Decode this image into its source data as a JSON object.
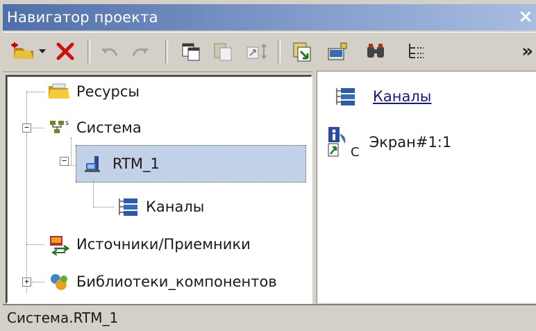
{
  "window": {
    "title": "Навигатор проекта",
    "close": "×"
  },
  "toolbar": {
    "items": [
      "new-icon",
      "dropdown-arrow-icon",
      "delete-icon",
      "undo-icon",
      "redo-icon",
      "copy-icon",
      "paste-icon",
      "move-icon",
      "export-icon",
      "properties-icon",
      "find-icon",
      "tree-view-icon"
    ],
    "overflow": "»"
  },
  "tree": {
    "resources": "Ресурсы",
    "system": "Система",
    "rtm": "RTM_1",
    "channels": "Каналы",
    "sources": "Источники/Приемники",
    "libraries": "Библиотеки_компонентов"
  },
  "list": {
    "channels_link": "Каналы",
    "screen": "Экран#1:1",
    "screen_badge": "C"
  },
  "status": {
    "path": "Система.RTM_1"
  },
  "colors": {
    "title_start": "#4f6fa8",
    "selection": "#c2d0e8",
    "link": "#1a1a6e"
  }
}
